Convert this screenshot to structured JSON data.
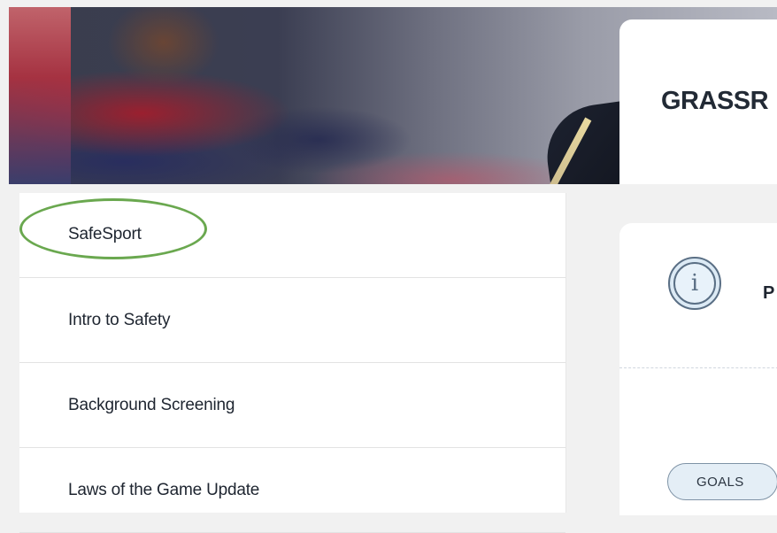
{
  "header": {
    "title": "GRASSR"
  },
  "nav": {
    "items": [
      {
        "label": "SafeSport"
      },
      {
        "label": "Intro to Safety"
      },
      {
        "label": "Background Screening"
      },
      {
        "label": "Laws of the Game Update"
      }
    ]
  },
  "info_card": {
    "icon": "info-icon",
    "icon_glyph": "i",
    "heading": "P",
    "tag": "GOALS"
  },
  "colors": {
    "highlight": "#6aa84f",
    "page_bg": "#f1f1f1",
    "text": "#1e2530"
  }
}
